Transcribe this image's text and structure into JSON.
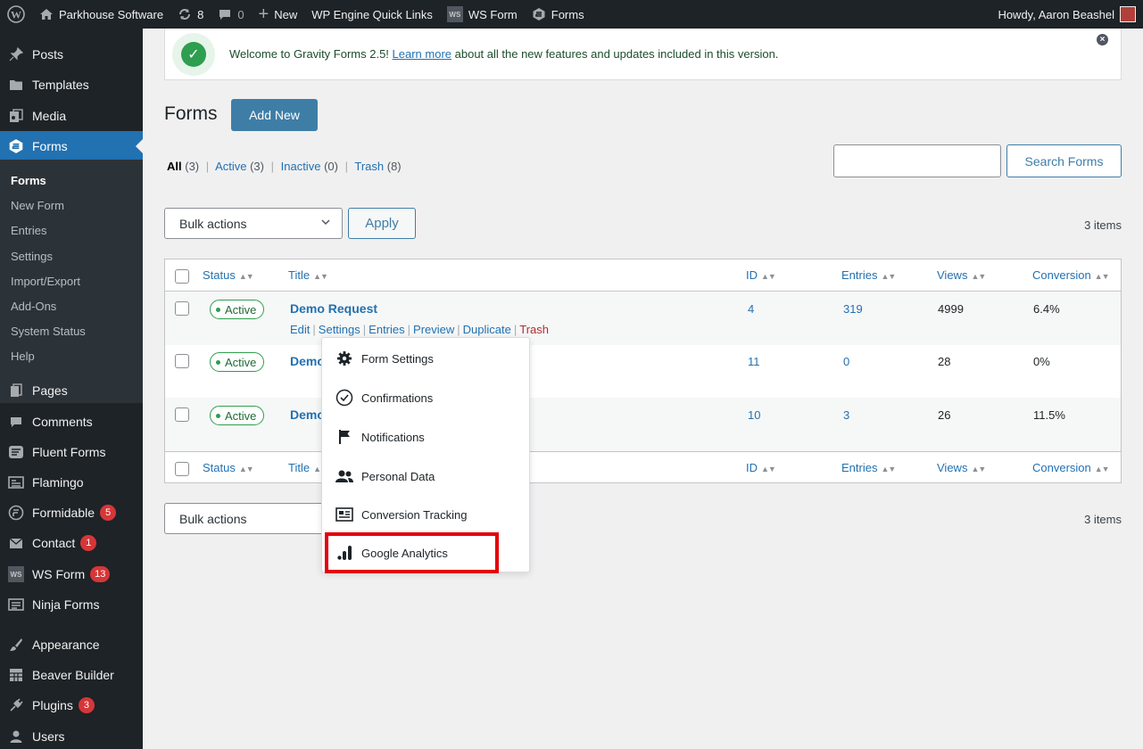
{
  "adminbar": {
    "site_name": "Parkhouse Software",
    "updates_count": "8",
    "comments_count": "0",
    "new_label": "New",
    "wp_engine_label": "WP Engine Quick Links",
    "ws_form_label": "WS Form",
    "forms_label": "Forms",
    "howdy": "Howdy, Aaron Beashel"
  },
  "sidebar": {
    "items": [
      {
        "label": "Posts",
        "icon": "pin-icon"
      },
      {
        "label": "Templates",
        "icon": "folder-icon"
      },
      {
        "label": "Media",
        "icon": "media-icon"
      },
      {
        "label": "Forms",
        "icon": "gravity-forms-icon"
      },
      {
        "label": "Pages",
        "icon": "pages-icon"
      },
      {
        "label": "Comments",
        "icon": "comment-icon"
      },
      {
        "label": "Fluent Forms",
        "icon": "fluent-icon"
      },
      {
        "label": "Flamingo",
        "icon": "flamingo-icon"
      },
      {
        "label": "Formidable",
        "icon": "formidable-icon",
        "badge": "5"
      },
      {
        "label": "Contact",
        "icon": "mail-icon",
        "badge": "1"
      },
      {
        "label": "WS Form",
        "icon": "ws-form-icon",
        "badge": "13"
      },
      {
        "label": "Ninja Forms",
        "icon": "ninja-icon"
      },
      {
        "label": "Appearance",
        "icon": "brush-icon"
      },
      {
        "label": "Beaver Builder",
        "icon": "grid-icon"
      },
      {
        "label": "Plugins",
        "icon": "plug-icon",
        "badge": "3"
      },
      {
        "label": "Users",
        "icon": "user-icon"
      }
    ],
    "submenu": [
      "Forms",
      "New Form",
      "Entries",
      "Settings",
      "Import/Export",
      "Add-Ons",
      "System Status",
      "Help"
    ]
  },
  "notice": {
    "text_before": "Welcome to Gravity Forms 2.5! ",
    "link": "Learn more",
    "text_after": " about all the new features and updates included in this version."
  },
  "page": {
    "title": "Forms",
    "add_new": "Add New",
    "search_button": "Search Forms",
    "search_value": ""
  },
  "filters": {
    "all": "All",
    "all_count": "(3)",
    "active": "Active",
    "active_count": "(3)",
    "inactive": "Inactive",
    "inactive_count": "(0)",
    "trash": "Trash",
    "trash_count": "(8)"
  },
  "bulk": {
    "label": "Bulk actions",
    "apply": "Apply",
    "items": "3 items"
  },
  "table": {
    "columns": [
      "Status",
      "Title",
      "ID",
      "Entries",
      "Views",
      "Conversion"
    ],
    "rows": [
      {
        "status": "Active",
        "title": "Demo Request",
        "id": "4",
        "entries": "319",
        "views": "4999",
        "conversion": "6.4%"
      },
      {
        "status": "Active",
        "title": "Demo",
        "id": "11",
        "entries": "0",
        "views": "28",
        "conversion": "0%"
      },
      {
        "status": "Active",
        "title": "Demo",
        "id": "10",
        "entries": "3",
        "views": "26",
        "conversion": "11.5%"
      }
    ],
    "row_actions": [
      "Edit",
      "Settings",
      "Entries",
      "Preview",
      "Duplicate",
      "Trash"
    ]
  },
  "settings_menu": {
    "items": [
      {
        "label": "Form Settings",
        "icon": "gear-icon"
      },
      {
        "label": "Confirmations",
        "icon": "check-circle-icon"
      },
      {
        "label": "Notifications",
        "icon": "flag-icon"
      },
      {
        "label": "Personal Data",
        "icon": "users-icon"
      },
      {
        "label": "Conversion Tracking",
        "icon": "tracking-icon"
      },
      {
        "label": "Google Analytics",
        "icon": "bar-chart-icon"
      }
    ]
  },
  "colors": {
    "wp_dark": "#1d2327",
    "wp_blue": "#2271b1",
    "button_blue": "#3e7ea6",
    "active_green": "#2e9e4f",
    "highlight_red": "#e3000b",
    "badge_red": "#d63638"
  }
}
